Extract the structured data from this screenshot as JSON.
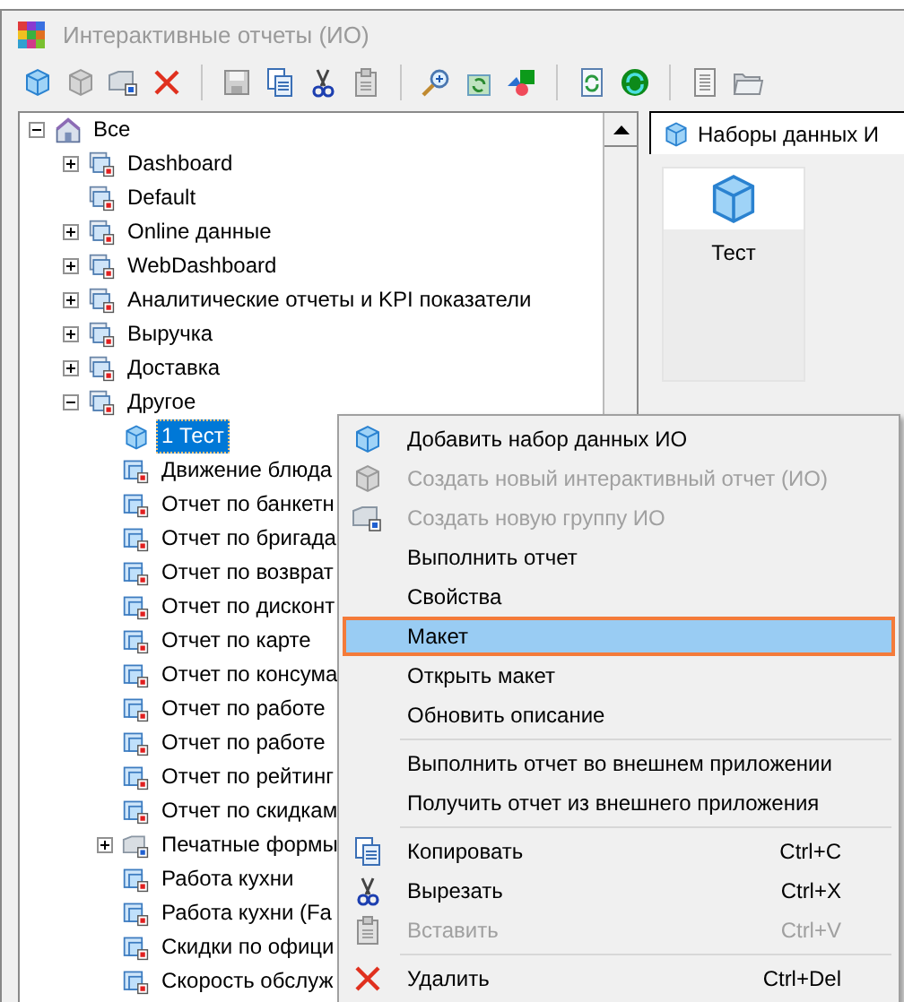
{
  "window": {
    "title": "Интерактивные отчеты (ИО)"
  },
  "tree": [
    {
      "label": "Все",
      "kind": "home",
      "expanded": true,
      "selected": false,
      "children": [
        {
          "label": "Dashboard",
          "kind": "group",
          "expanded": false,
          "selected": false
        },
        {
          "label": "Default",
          "kind": "group",
          "selected": false
        },
        {
          "label": "Online данные",
          "kind": "group",
          "expanded": false,
          "selected": false
        },
        {
          "label": "WebDashboard",
          "kind": "group",
          "expanded": false,
          "selected": false
        },
        {
          "label": "Аналитические отчеты и KPI показатели",
          "kind": "group",
          "expanded": false,
          "selected": false
        },
        {
          "label": "Выручка",
          "kind": "group",
          "expanded": false,
          "selected": false
        },
        {
          "label": "Доставка",
          "kind": "group",
          "expanded": false,
          "selected": false
        },
        {
          "label": "Другое",
          "kind": "group",
          "expanded": true,
          "selected": false,
          "children": [
            {
              "label": "1 Тест",
              "kind": "dataset",
              "selected": true
            },
            {
              "label": "Движение блюда",
              "kind": "report",
              "selected": false
            },
            {
              "label": "Отчет по банкетн",
              "kind": "report",
              "selected": false
            },
            {
              "label": "Отчет по бригада",
              "kind": "report",
              "selected": false
            },
            {
              "label": "Отчет по возврат",
              "kind": "report",
              "selected": false
            },
            {
              "label": "Отчет по дисконт",
              "kind": "report",
              "selected": false
            },
            {
              "label": "Отчет по карте",
              "kind": "report",
              "selected": false
            },
            {
              "label": "Отчет по консума",
              "kind": "report",
              "selected": false
            },
            {
              "label": "Отчет по работе",
              "kind": "report",
              "selected": false
            },
            {
              "label": "Отчет по работе",
              "kind": "report",
              "selected": false
            },
            {
              "label": "Отчет по рейтинг",
              "kind": "report",
              "selected": false
            },
            {
              "label": "Отчет по скидкам",
              "kind": "report",
              "selected": false
            },
            {
              "label": "Печатные формы",
              "kind": "group-grey",
              "expanded": false,
              "selected": false
            },
            {
              "label": "Работа кухни",
              "kind": "report",
              "selected": false
            },
            {
              "label": "Работа кухни (Fa",
              "kind": "report",
              "selected": false
            },
            {
              "label": "Скидки по офици",
              "kind": "report",
              "selected": false
            },
            {
              "label": "Скорость обслуж",
              "kind": "report",
              "selected": false
            }
          ]
        }
      ]
    }
  ],
  "right_panel": {
    "tab": "Наборы данных И",
    "tiles": [
      {
        "label": "Тест"
      }
    ]
  },
  "context_menu": [
    {
      "kind": "add",
      "label": "Добавить набор данных ИО",
      "disabled": false,
      "selected": false
    },
    {
      "kind": "create-report",
      "label": "Создать новый интерактивный отчет (ИО)",
      "disabled": true,
      "selected": false
    },
    {
      "kind": "create-group",
      "label": "Создать новую группу ИО",
      "disabled": true,
      "selected": false
    },
    {
      "kind": "plain",
      "label": "Выполнить отчет",
      "disabled": false,
      "selected": false
    },
    {
      "kind": "plain",
      "label": "Свойства",
      "disabled": false,
      "selected": false
    },
    {
      "kind": "plain",
      "label": "Макет",
      "disabled": false,
      "selected": true
    },
    {
      "kind": "plain",
      "label": "Открыть макет",
      "disabled": false,
      "selected": false
    },
    {
      "kind": "plain",
      "label": "Обновить описание",
      "disabled": false,
      "selected": false
    },
    {
      "kind": "separator"
    },
    {
      "kind": "plain",
      "label": "Выполнить отчет во внешнем приложении",
      "disabled": false,
      "selected": false
    },
    {
      "kind": "plain",
      "label": "Получить отчет из внешнего приложения",
      "disabled": false,
      "selected": false
    },
    {
      "kind": "separator"
    },
    {
      "kind": "copy",
      "label": "Копировать",
      "shortcut": "Ctrl+C",
      "disabled": false,
      "selected": false
    },
    {
      "kind": "cut",
      "label": "Вырезать",
      "shortcut": "Ctrl+X",
      "disabled": false,
      "selected": false
    },
    {
      "kind": "paste",
      "label": "Вставить",
      "shortcut": "Ctrl+V",
      "disabled": true,
      "selected": false
    },
    {
      "kind": "separator"
    },
    {
      "kind": "delete",
      "label": "Удалить",
      "shortcut": "Ctrl+Del",
      "disabled": false,
      "selected": false
    }
  ]
}
